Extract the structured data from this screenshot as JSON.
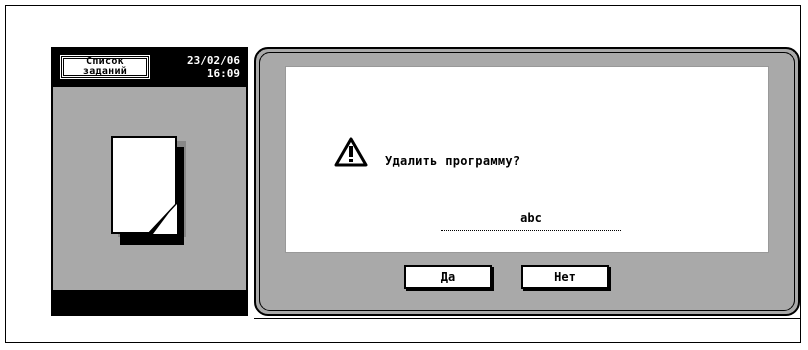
{
  "header": {
    "job_list_line1": "Список",
    "job_list_line2": "заданий",
    "date": "23/02/06",
    "time": "16:09"
  },
  "dialog": {
    "message": "Удалить программу?",
    "program_name": "abc",
    "yes_label": "Да",
    "no_label": "Нет"
  },
  "icons": {
    "warning": "warning-triangle-icon",
    "document": "document-icon"
  }
}
